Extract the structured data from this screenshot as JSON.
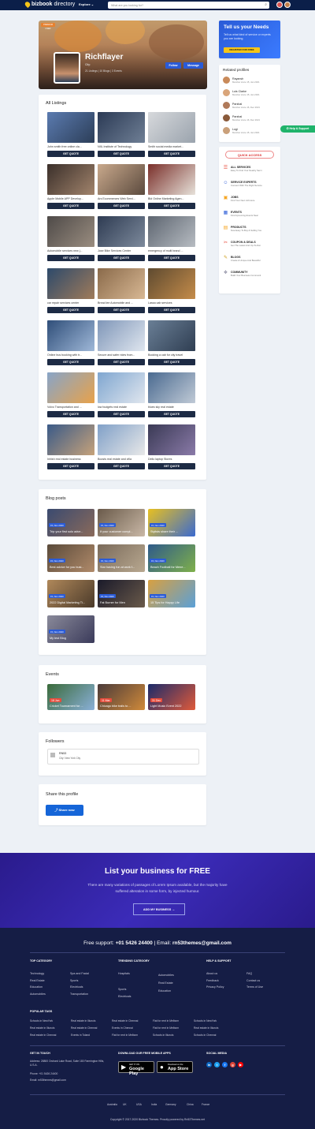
{
  "nav": {
    "brand_bold": "bizbook",
    "brand_light": "directory",
    "explore": "Explore",
    "search_placeholder": "What are you looking for?"
  },
  "profile": {
    "badge": "PREMIUM USER",
    "name": "Richflayer",
    "city": "City:",
    "stats": "21 Listings | 10 Blogs | 3 Events",
    "follow": "Follow",
    "message": "Message"
  },
  "listings": {
    "title": "All Listings",
    "get_quote": "GET QUOTE",
    "items": [
      "John smith free online cla...",
      "NIIL Institute of Technology",
      "Smith social media market...",
      "Apple Mobile APP Develop...",
      "Ars Ecommerces Web Servi...",
      "Bld Online Marketing Agen...",
      "Automobile services new j...",
      "Jose Bike Services Center",
      "emergency of multi brand ...",
      "car repair services center",
      "Bread lee Automobile and ...",
      "Lassa cab services",
      "Online bus booking with tr...",
      "Secure and safer rides from...",
      "Booking a cab for city travel",
      "Volvo Transportation and ...",
      "low budgets real estate",
      "blues sky real estate",
      "Inhish real estate business",
      "Boosts real estate and villa",
      "Dello laptop Stores"
    ]
  },
  "blogs": {
    "title": "Blog posts",
    "items": [
      {
        "date": "15, Nov 2020",
        "title": "Trip your first solo adve..."
      },
      {
        "date": "15, Nov 2020",
        "title": "If your customer compl..."
      },
      {
        "date": "15, Nov 2020",
        "title": "Stylists share their ..."
      },
      {
        "date": "15, Nov 2020",
        "title": "Best advice for you busi..."
      },
      {
        "date": "15, Nov 2020",
        "title": "Star having fun at work f..."
      },
      {
        "date": "15, Nov 2020",
        "title": "Beach Football for Mene..."
      },
      {
        "date": "15, Nov 2020",
        "title": "2022 Digital Marketing Ti..."
      },
      {
        "date": "15, Nov 2020",
        "title": "Fat Burner for Men"
      },
      {
        "date": "15, Nov 2020",
        "title": "15 Tips for Happy Life"
      },
      {
        "date": "15, Nov 2020",
        "title": "My test Blog"
      }
    ]
  },
  "events": {
    "title": "Events",
    "items": [
      {
        "date": "18 Jun",
        "title": "Cricket Tournament for ..."
      },
      {
        "date": "11 Mar",
        "title": "Chicago bike trails to ..."
      },
      {
        "date": "31 Dec",
        "title": "Light Music Event 2022"
      }
    ]
  },
  "followers": {
    "title": "Followers",
    "name": "RN53",
    "city": "City: New York City"
  },
  "share": {
    "title": "Share this profile",
    "button": "Share now"
  },
  "promo": {
    "title": "Tell us your Needs",
    "desc": "Tell us what kind of service or experts you are looking.",
    "button": "REGISTER FOR FREE"
  },
  "related": {
    "title": "Related profiles",
    "people": [
      {
        "name": "Rayansh",
        "meta": "Member since 15, Jan 2021"
      },
      {
        "name": "Luis Clarke",
        "meta": "Member since 15, Jan 2021"
      },
      {
        "name": "Parshal",
        "meta": "Member since 16, Dec 2021"
      },
      {
        "name": "Parshal",
        "meta": "Member since 16, Dec 2021"
      },
      {
        "name": "Logi",
        "meta": "Member since 15, Jan 2021"
      }
    ]
  },
  "help_button": "Help & Support",
  "quick_access": {
    "title": "QUICK ACCESS",
    "items": [
      {
        "label": "ALL SERVICES",
        "desc": "Easy To Find Your Nearby Servi"
      },
      {
        "label": "SERVICE EXPERTS",
        "desc": "Connect With The Right Service"
      },
      {
        "label": "JOBS",
        "desc": "Find Your Next Job Here"
      },
      {
        "label": "EVENTS",
        "desc": "Find Upcoming Events Near"
      },
      {
        "label": "PRODUCTS",
        "desc": "Now Easy To Buy & Selling You"
      },
      {
        "label": "COUPON & DEALS",
        "desc": "Get The Latest And Up-To-Dat"
      },
      {
        "label": "BLOGS",
        "desc": "Create A Unique And Beautiful"
      },
      {
        "label": "COMMUNITY",
        "desc": "Build Your Business Communit"
      }
    ]
  },
  "list_business": {
    "title": "List your business for FREE",
    "text1": "There are many variations of passages of Lorem Ipsum available, but the majority have",
    "text2": "suffered alteration in some form, by injected humour.",
    "button": "ADD MY BUSINESS"
  },
  "footer": {
    "support_label": "Free support:",
    "phone": "+01 5426 24400",
    "email_label": "Email:",
    "email": "rn53themes@gmail.com",
    "top_category": {
      "title": "TOP CATEGORY",
      "col1": [
        "Technology",
        "Real Estate",
        "Education",
        "Automobiles"
      ],
      "col2": [
        "Spa and Facial",
        "Sports",
        "Electricals",
        "Transportation"
      ]
    },
    "trending": {
      "title": "TRENDING CATEGORY",
      "col1": [
        "Hospitals",
        "Sports",
        "Electricals"
      ],
      "col2": [
        "Automobiles",
        "Real Estate",
        "Education"
      ]
    },
    "help": {
      "title": "HELP & SUPPORT",
      "col1": [
        "About us",
        "Feedback",
        "Privacy Policy"
      ],
      "col2": [
        "FAQ",
        "Contact us",
        "Terms of Use"
      ]
    },
    "tags_title": "POPULAR TAGS",
    "tags": [
      "Schools in NewYork",
      "Real estate in Illunois",
      "Real estate in Chennai",
      "Flat for rent in Melborn",
      "Schools in NewYork",
      "Real estate in Illunois",
      "Real estate in Chennai",
      "Events in Chennai",
      "Flat for rent in Melborn",
      "Real estate in Illunois",
      "Real estate in Chennai",
      "Events in Toland",
      "Flat for rent in Melborn",
      "Schools in Illunois",
      "Schools in Chennai"
    ],
    "touch_title": "GET IN TOUCH",
    "address": "Address: 28800 Orchard Lake Road, Suite 180 Farmington Hills, U.S.A.",
    "phone_line": "Phone: +01 5426 24400",
    "email_line": "Email: rn53themes@gmail.com",
    "apps_title": "DOWNLOAD OUR FREE MOBILE APPS",
    "google_small": "GET IT ON",
    "google_big": "Google Play",
    "apple_small": "Download on the",
    "apple_big": "App Store",
    "social_title": "SOCIAL MEDIA",
    "countries": [
      "Australia",
      "UK",
      "USA",
      "India",
      "Germany",
      "China",
      "France"
    ],
    "copyright": "Copyright © 2017-2020 Bizbook Themes. Proudly powered by Rn53Themes.net"
  }
}
